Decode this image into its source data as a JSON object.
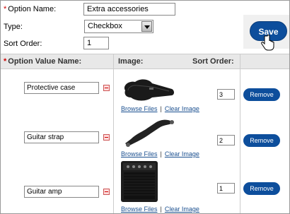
{
  "form": {
    "option_name_label": "Option Name:",
    "option_name_value": "Extra accessories",
    "type_label": "Type:",
    "type_value": "Checkbox",
    "sort_order_label": "Sort Order:",
    "sort_order_value": "1",
    "required_marker": "*"
  },
  "toolbar": {
    "save_label": "Save"
  },
  "table": {
    "headers": {
      "option_value_name": "Option Value Name:",
      "image": "Image:",
      "sort_order": "Sort Order:"
    },
    "browse_label": "Browse Files",
    "separator": "|",
    "clear_label": "Clear Image",
    "remove_label": "Remove",
    "rows": [
      {
        "name": "Protective case",
        "sort": "3",
        "image_icon": "guitar-case-image"
      },
      {
        "name": "Guitar strap",
        "sort": "2",
        "image_icon": "guitar-strap-image"
      },
      {
        "name": "Guitar amp",
        "sort": "1",
        "image_icon": "guitar-amp-image"
      }
    ]
  },
  "colors": {
    "button": "#0d4e9c",
    "required": "#cc0000",
    "header_bg": "#e8e8e8"
  }
}
